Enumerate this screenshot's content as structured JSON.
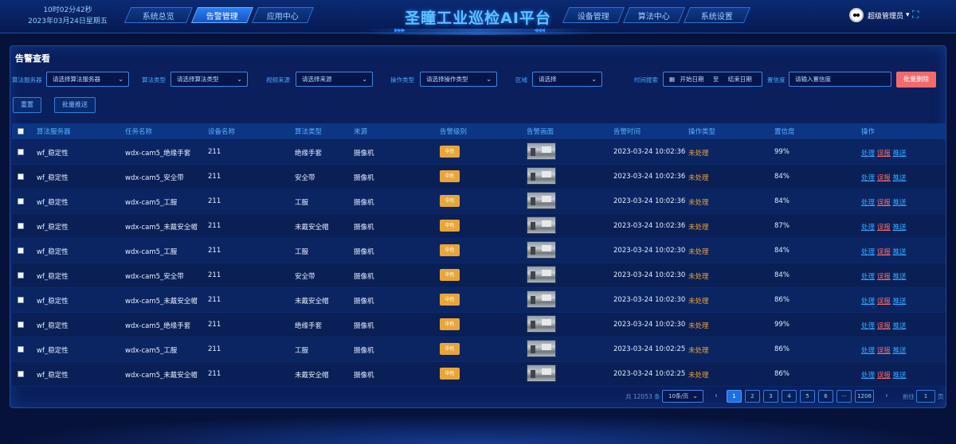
{
  "header": {
    "time": "10时02分42秒",
    "date": "2023年03月24日星期五",
    "title": "圣瞳工业巡检AI平台",
    "nav_left": [
      "系统总览",
      "告警管理",
      "应用中心"
    ],
    "nav_right": [
      "设备管理",
      "算法中心",
      "系统设置"
    ],
    "active_nav": "告警管理",
    "user": "超级管理员",
    "user_chevron": "▾",
    "fullscreen_icon": "fullscreen-icon",
    "colors": {
      "accent": "#2f8cff",
      "title": "#5fc2ff",
      "active_tab": "#2d7ff0"
    }
  },
  "panel": {
    "title": "告警查看",
    "filters": {
      "server_label": "算法服务器",
      "server_placeholder": "请选择算法服务器",
      "algo_label": "算法类型",
      "algo_placeholder": "请选择算法类型",
      "source_label": "视频来源",
      "source_placeholder": "请选择来源",
      "op_label": "操作类型",
      "op_placeholder": "请选择操作类型",
      "area_label": "区域",
      "area_placeholder": "请选择",
      "time_label": "时间搜索",
      "start_placeholder": "开始日期",
      "range_sep": "至",
      "end_placeholder": "结束日期",
      "conf_label": "置信度",
      "conf_placeholder": "请输入置信度"
    },
    "buttons": {
      "batch_delete": "批量删除",
      "reset": "重置",
      "batch_push": "批量推送"
    },
    "table": {
      "headers": [
        "算法服务器",
        "任务名称",
        "设备名称",
        "算法类型",
        "来源",
        "告警级别",
        "告警画面",
        "告警时间",
        "操作类型",
        "置信度",
        "操作"
      ],
      "level": "中危",
      "status": "未处理",
      "actions": [
        "处理",
        "误报",
        "推送"
      ],
      "rows": [
        {
          "server": "wf_稳定性",
          "task": "wdx-cam5_绝缘手套",
          "device": "211",
          "algo": "绝缘手套",
          "source": "摄像机",
          "time": "2023-03-24 10:02:36",
          "conf": "99%"
        },
        {
          "server": "wf_稳定性",
          "task": "wdx-cam5_安全带",
          "device": "211",
          "algo": "安全带",
          "source": "摄像机",
          "time": "2023-03-24 10:02:36",
          "conf": "84%"
        },
        {
          "server": "wf_稳定性",
          "task": "wdx-cam5_工服",
          "device": "211",
          "algo": "工服",
          "source": "摄像机",
          "time": "2023-03-24 10:02:36",
          "conf": "84%"
        },
        {
          "server": "wf_稳定性",
          "task": "wdx-cam5_未戴安全帽",
          "device": "211",
          "algo": "未戴安全帽",
          "source": "摄像机",
          "time": "2023-03-24 10:02:36",
          "conf": "87%"
        },
        {
          "server": "wf_稳定性",
          "task": "wdx-cam5_工服",
          "device": "211",
          "algo": "工服",
          "source": "摄像机",
          "time": "2023-03-24 10:02:30",
          "conf": "84%"
        },
        {
          "server": "wf_稳定性",
          "task": "wdx-cam5_安全带",
          "device": "211",
          "algo": "安全带",
          "source": "摄像机",
          "time": "2023-03-24 10:02:30",
          "conf": "84%"
        },
        {
          "server": "wf_稳定性",
          "task": "wdx-cam5_未戴安全帽",
          "device": "211",
          "algo": "未戴安全帽",
          "source": "摄像机",
          "time": "2023-03-24 10:02:30",
          "conf": "86%"
        },
        {
          "server": "wf_稳定性",
          "task": "wdx-cam5_绝缘手套",
          "device": "211",
          "algo": "绝缘手套",
          "source": "摄像机",
          "time": "2023-03-24 10:02:30",
          "conf": "99%"
        },
        {
          "server": "wf_稳定性",
          "task": "wdx-cam5_工服",
          "device": "211",
          "algo": "工服",
          "source": "摄像机",
          "time": "2023-03-24 10:02:25",
          "conf": "86%"
        },
        {
          "server": "wf_稳定性",
          "task": "wdx-cam5_未戴安全帽",
          "device": "211",
          "algo": "未戴安全帽",
          "source": "摄像机",
          "time": "2023-03-24 10:02:25",
          "conf": "86%"
        }
      ]
    },
    "pagination": {
      "total": "共 12053 条",
      "page_size": "10条/页",
      "pages": [
        "1",
        "2",
        "3",
        "4",
        "5",
        "6",
        "···",
        "1206"
      ],
      "current": "1",
      "prev": "‹",
      "next": "›",
      "goto_label": "前往",
      "goto_value": "1",
      "goto_suffix": "页"
    }
  }
}
